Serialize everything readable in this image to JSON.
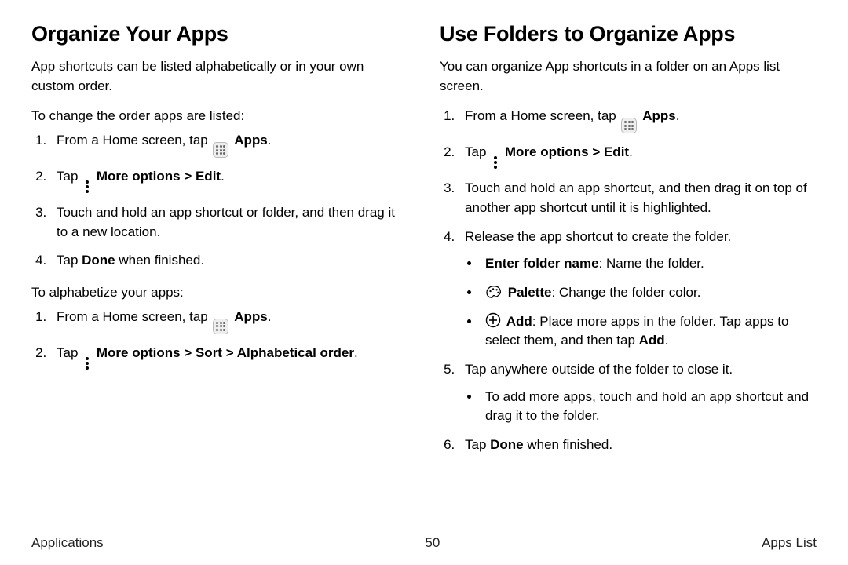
{
  "left": {
    "heading": "Organize Your Apps",
    "intro": "App shortcuts can be listed alphabetically or in your own custom order.",
    "p1": "To change the order apps are listed:",
    "s1a": "From a Home screen, tap ",
    "s1b": "Apps",
    "s1c": ".",
    "s2a": "Tap ",
    "s2b": "More options",
    "s2c": " > ",
    "s2d": "Edit",
    "s2e": ".",
    "s3": "Touch and hold an app shortcut or folder, and then drag it to a new location.",
    "s4a": "Tap ",
    "s4b": "Done",
    "s4c": " when finished.",
    "p2": "To alphabetize your apps:",
    "a1a": "From a Home screen, tap ",
    "a1b": "Apps",
    "a1c": ".",
    "a2a": "Tap ",
    "a2b": "More options",
    "a2c": " > ",
    "a2d": "Sort",
    "a2e": " > ",
    "a2f": "Alphabetical order",
    "a2g": "."
  },
  "right": {
    "heading": "Use Folders to Organize Apps",
    "intro": "You can organize App shortcuts in a folder on an Apps list screen.",
    "s1a": "From a Home screen, tap ",
    "s1b": "Apps",
    "s1c": ".",
    "s2a": "Tap ",
    "s2b": "More options",
    "s2c": " > ",
    "s2d": "Edit",
    "s2e": ".",
    "s3": "Touch and hold an app shortcut, and then drag it on top of another app shortcut until it is highlighted.",
    "s4": "Release the app shortcut to create the folder.",
    "b1a": "Enter folder name",
    "b1b": ": Name the folder.",
    "b2a": "Palette",
    "b2b": ": Change the folder color.",
    "b3a": "Add",
    "b3b": ": Place more apps in the folder. Tap apps to select them, and then tap ",
    "b3c": "Add",
    "b3d": ".",
    "s5": "Tap anywhere outside of the folder to close it.",
    "b5": "To add more apps, touch and hold an app shortcut and drag it to the folder.",
    "s6a": "Tap ",
    "s6b": "Done",
    "s6c": " when finished."
  },
  "footer": {
    "left": "Applications",
    "page": "50",
    "right": "Apps List"
  }
}
